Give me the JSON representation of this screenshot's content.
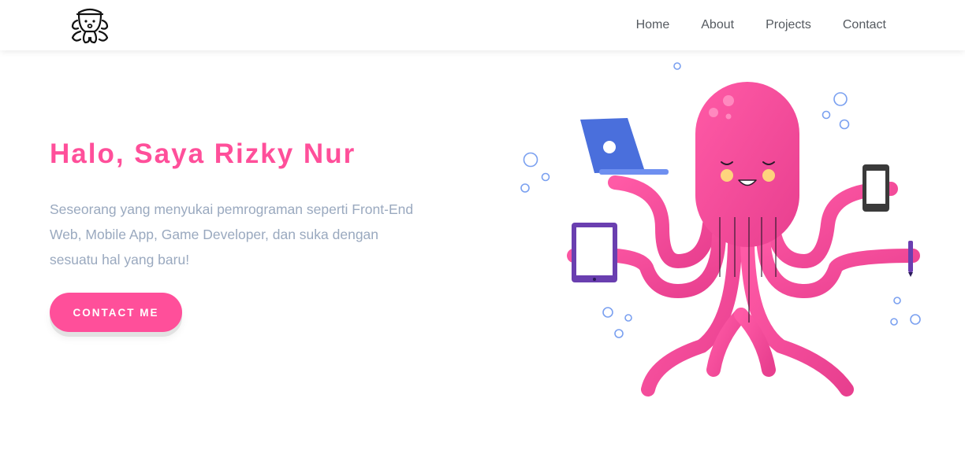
{
  "nav": {
    "logo_icon": "octopus-logo-icon",
    "links": [
      {
        "label": "Home"
      },
      {
        "label": "About"
      },
      {
        "label": "Projects"
      },
      {
        "label": "Contact"
      }
    ]
  },
  "hero": {
    "title": "Halo, Saya Rizky Nur",
    "description": "Seseorang yang menyukai pemrograman seperti Front-End Web, Mobile App, Game Developer, dan suka dengan sesuatu hal yang baru!",
    "cta_label": "CONTACT ME",
    "illustration_icon": "octopus-multitasking-illustration"
  },
  "colors": {
    "accent": "#ff4f9a",
    "text_muted": "#9aa9bf",
    "nav_text": "#555a60"
  }
}
